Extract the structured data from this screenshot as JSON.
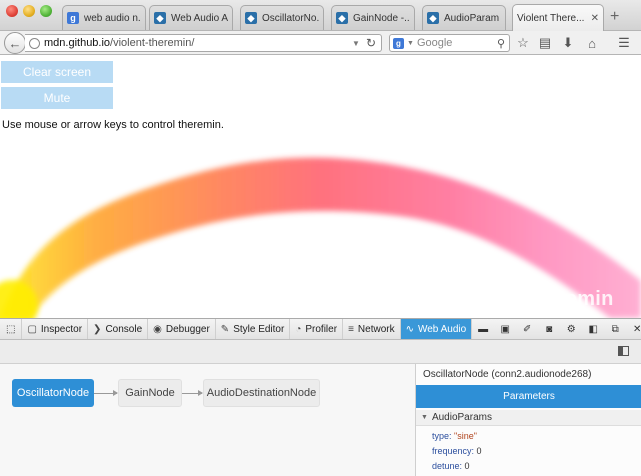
{
  "browser": {
    "tabs": [
      {
        "label": "web audio n...",
        "favicon": "google-icon"
      },
      {
        "label": "Web Audio A...",
        "favicon": "mdn-icon"
      },
      {
        "label": "OscillatorNo...",
        "favicon": "mdn-icon"
      },
      {
        "label": "GainNode -...",
        "favicon": "mdn-icon"
      },
      {
        "label": "AudioParam ...",
        "favicon": "mdn-icon"
      },
      {
        "label": "Violent There...",
        "favicon": "none",
        "active": true
      }
    ],
    "url_host": "mdn.github.io",
    "url_path": "/violent-theremin/",
    "search_placeholder": "Google",
    "search_engine_letter": "g"
  },
  "page": {
    "buttons": {
      "clear": "Clear screen",
      "mute": "Mute"
    },
    "hint": "Use mouse or arrow keys to control theremin.",
    "brand": "Violent Theremin"
  },
  "devtools": {
    "tools": [
      {
        "label": "Inspector",
        "icon": "inspector-icon",
        "glyph": "▢"
      },
      {
        "label": "Console",
        "icon": "console-icon",
        "glyph": "❯"
      },
      {
        "label": "Debugger",
        "icon": "debugger-icon",
        "glyph": "◉"
      },
      {
        "label": "Style Editor",
        "icon": "style-editor-icon",
        "glyph": "✎"
      },
      {
        "label": "Profiler",
        "icon": "profiler-icon",
        "glyph": "◔"
      },
      {
        "label": "Network",
        "icon": "network-icon",
        "glyph": "≡"
      },
      {
        "label": "Web Audio",
        "icon": "web-audio-icon",
        "glyph": "∿",
        "active": true
      }
    ],
    "graph": {
      "nodes": [
        "OscillatorNode",
        "GainNode",
        "AudioDestinationNode"
      ]
    },
    "inspector": {
      "title": "OscillatorNode (conn2.audionode268)",
      "tab": "Parameters",
      "section": "AudioParams",
      "props": [
        {
          "key": "type:",
          "value": "\"sine\"",
          "is_string": true
        },
        {
          "key": "frequency:",
          "value": "0",
          "is_string": false
        },
        {
          "key": "detune:",
          "value": "0",
          "is_string": false
        }
      ]
    }
  },
  "colors": {
    "accent": "#2e8fd6",
    "page_button": "#b8dbf4",
    "web_audio_tab": "#3a98d8"
  }
}
